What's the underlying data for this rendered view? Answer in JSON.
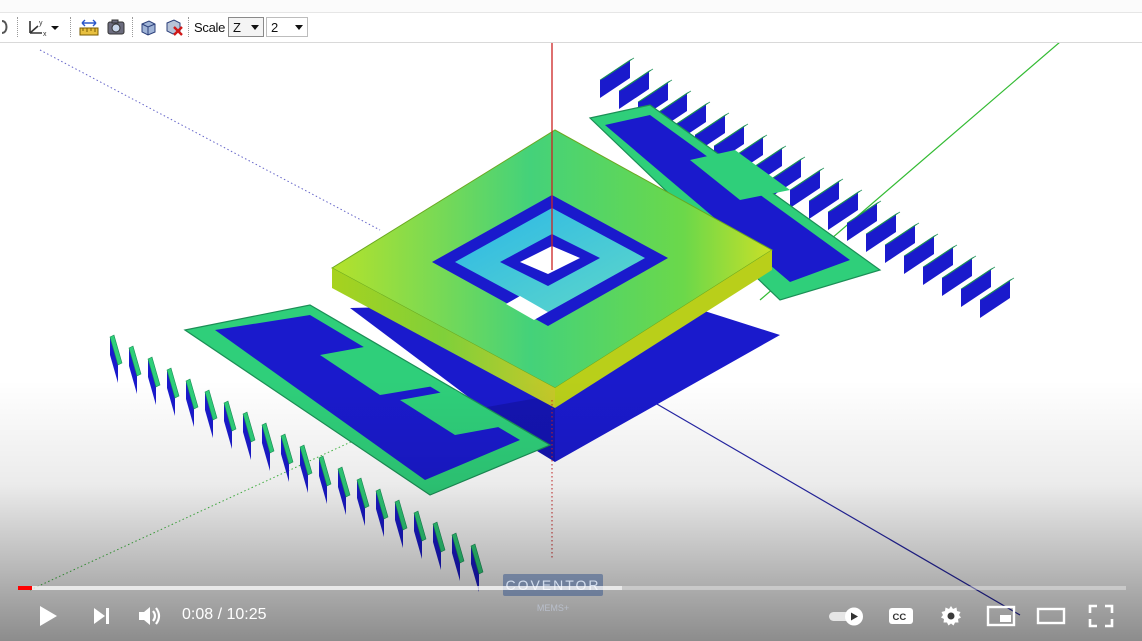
{
  "toolbar": {
    "scale_label": "Scale",
    "scale_axis": "Z",
    "scale_value": "2",
    "icons": [
      "axis-orient-icon",
      "measure-icon",
      "camera-icon",
      "cube-icon",
      "cube-delete-icon"
    ]
  },
  "viewport": {
    "axis_colors": {
      "z": "#cc2222",
      "x": "#2222aa",
      "y": "#33bb33",
      "dotted_y": "#6a6acc"
    },
    "mesh_colors": {
      "electrode": "#1a1acc",
      "comb_green": "#2fcf7a",
      "plate_top": "#a8e030",
      "plate_mid": "#3cd67a",
      "plate_inner": "#3aa8e0"
    }
  },
  "watermark": {
    "brand": "COVENTOR",
    "sub": "MEMS+"
  },
  "player": {
    "current_time": "0:08",
    "duration": "10:25",
    "time_display": "0:08 / 10:25",
    "progress_played": 0.0128,
    "progress_loaded": 0.545,
    "autoplay": "on",
    "accent_color": "#ff0000"
  }
}
